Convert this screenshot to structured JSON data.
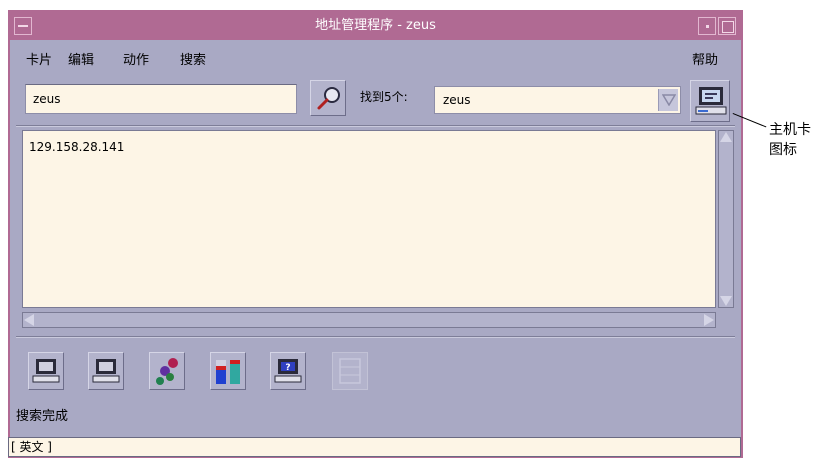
{
  "window": {
    "title": "地址管理程序 - zeus"
  },
  "menubar": {
    "items": [
      "卡片",
      "编辑",
      "动作",
      "搜索"
    ],
    "help": "帮助"
  },
  "search": {
    "value": "zeus"
  },
  "results": {
    "found_label": "找到5个:",
    "selected": "zeus"
  },
  "detail": {
    "text": "129.158.28.141"
  },
  "status": {
    "text": "搜索完成"
  },
  "ime": {
    "text": "[ 英文 ]"
  },
  "callout": {
    "line1": "主机卡",
    "line2": "图标"
  },
  "toolbar": {
    "icons": [
      "host-card-icon",
      "host-card-icon",
      "gears-icon",
      "bar-chart-icon",
      "help-card-icon",
      "blank-card-icon"
    ]
  },
  "colors": {
    "titlebar": "#b06a93",
    "window_bg": "#a9a9c4",
    "field_bg": "#fdf5e6"
  }
}
